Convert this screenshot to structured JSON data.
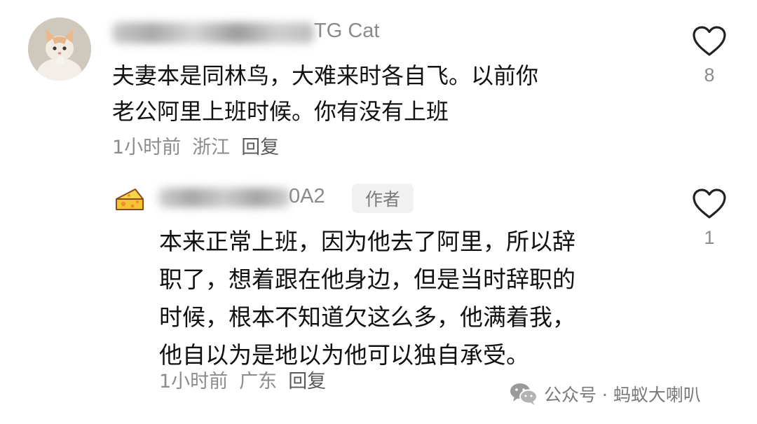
{
  "main_comment": {
    "username_visible": "TG Cat",
    "text_lines": [
      "夫妻本是同林鸟，大难来时各自飞。以前你",
      "老公阿里上班时候。你有没有上班"
    ],
    "time": "1小时前",
    "location": "浙江",
    "reply_label": "回复",
    "likes": "8"
  },
  "reply_comment": {
    "username_visible": "0A2",
    "author_badge": "作者",
    "text_lines": [
      "本来正常上班，因为他去了阿里，所以辞",
      "职了，想着跟在他身边，但是当时辞职的",
      "时候，根本不知道欠这么多，他满着我，",
      "他自以为是地以为他可以独自承受。"
    ],
    "time": "1小时前",
    "location": "广东",
    "reply_label": "回复",
    "likes": "1"
  },
  "watermark": {
    "text": "公众号 · 蚂蚁大喇叭",
    "icon": "wechat-icon"
  },
  "icons": {
    "like": "heart-outline-icon",
    "reply_avatar": "cheese-icon"
  },
  "colors": {
    "meta_gray": "#8c8c8c",
    "badge_bg": "#f1f1f1",
    "cheese_yellow": "#f6c432",
    "cheese_orange": "#f08a2a"
  }
}
